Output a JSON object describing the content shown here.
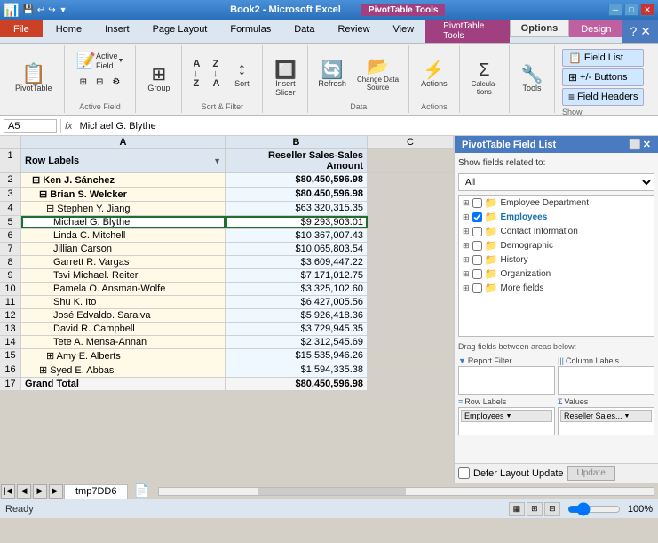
{
  "app": {
    "title": "Book2 - Microsoft Excel",
    "pivot_tools_label": "PivotTable Tools"
  },
  "title_buttons": [
    "─",
    "□",
    "✕"
  ],
  "tabs": {
    "main": [
      "File",
      "Home",
      "Insert",
      "Page Layout",
      "Formulas",
      "Data",
      "Review",
      "View"
    ],
    "pivot": [
      "Options",
      "Design"
    ]
  },
  "ribbon": {
    "groups": {
      "pivot_table": {
        "label": "PivotTable",
        "buttons": [
          "PivotTable"
        ]
      },
      "active_field": {
        "label": "Active Field",
        "main": "Active\nField"
      },
      "group_btn": "Group",
      "sort_filter": {
        "label": "Sort & Filter",
        "sort": "Sort"
      },
      "insert_slicer": "Insert\nSlicer",
      "data": {
        "label": "Data",
        "refresh": "Refresh",
        "change_data_source": "Change Data\nSource"
      },
      "actions": {
        "label": "Actions",
        "actions": "Actions"
      },
      "calculations": "Calculations",
      "tools": "Tools"
    },
    "show": {
      "label": "Show",
      "field_list": "Field List",
      "buttons": "+/- Buttons",
      "field_headers": "Field Headers"
    }
  },
  "formula_bar": {
    "cell_ref": "A5",
    "value": "Michael G. Blythe"
  },
  "spreadsheet": {
    "columns": [
      "",
      "A",
      "B",
      "C"
    ],
    "col_headers": [
      "Row Labels",
      "Reseller Sales-Sales Amount"
    ],
    "rows": [
      {
        "num": 1,
        "indent": 0,
        "label": "Row Labels",
        "value": "Reseller Sales-Sales Amount",
        "is_header": true
      },
      {
        "num": 2,
        "indent": 1,
        "label": "⊟ Ken J. Sánchez",
        "value": "$80,450,596.98",
        "bold": true
      },
      {
        "num": 3,
        "indent": 2,
        "label": "⊟ Brian S. Welcker",
        "value": "$80,450,596.98",
        "bold": true
      },
      {
        "num": 4,
        "indent": 3,
        "label": "⊟ Stephen Y. Jiang",
        "value": "$63,320,315.35",
        "bold": false
      },
      {
        "num": 5,
        "indent": 4,
        "label": "Michael G. Blythe",
        "value": "$9,293,903.01",
        "active": true
      },
      {
        "num": 6,
        "indent": 4,
        "label": "Linda C. Mitchell",
        "value": "$10,367,007.43"
      },
      {
        "num": 7,
        "indent": 4,
        "label": "Jillian Carson",
        "value": "$10,065,803.54"
      },
      {
        "num": 8,
        "indent": 4,
        "label": "Garrett R. Vargas",
        "value": "$3,609,447.22"
      },
      {
        "num": 9,
        "indent": 4,
        "label": "Tsvi Michael. Reiter",
        "value": "$7,171,012.75"
      },
      {
        "num": 10,
        "indent": 4,
        "label": "Pamela O. Ansman-Wolfe",
        "value": "$3,325,102.60"
      },
      {
        "num": 11,
        "indent": 4,
        "label": "Shu K. Ito",
        "value": "$6,427,005.56"
      },
      {
        "num": 12,
        "indent": 4,
        "label": "José Edvaldo. Saraiva",
        "value": "$5,926,418.36"
      },
      {
        "num": 13,
        "indent": 4,
        "label": "David R. Campbell",
        "value": "$3,729,945.35"
      },
      {
        "num": 14,
        "indent": 4,
        "label": "Tete A. Mensa-Annan",
        "value": "$2,312,545.69"
      },
      {
        "num": 15,
        "indent": 3,
        "label": "⊞ Amy E. Alberts",
        "value": "$15,535,946.26",
        "bold": false
      },
      {
        "num": 16,
        "indent": 2,
        "label": "⊞ Syed E. Abbas",
        "value": "$1,594,335.38",
        "bold": false
      },
      {
        "num": 17,
        "indent": 0,
        "label": "Grand Total",
        "value": "$80,450,596.98",
        "bold": true,
        "grand": true
      }
    ]
  },
  "pivot_panel": {
    "title": "PivotTable Field List",
    "show_label": "Show fields related to:",
    "dropdown_value": "(All)",
    "fields": [
      {
        "name": "Employee Department",
        "type": "folder",
        "expanded": false,
        "checked": false
      },
      {
        "name": "Employees",
        "type": "folder",
        "expanded": false,
        "checked": true
      },
      {
        "name": "Contact Information",
        "type": "folder",
        "expanded": false,
        "checked": false
      },
      {
        "name": "Demographic",
        "type": "folder",
        "expanded": false,
        "checked": false
      },
      {
        "name": "History",
        "type": "folder",
        "expanded": false,
        "checked": false
      },
      {
        "name": "Organization",
        "type": "folder",
        "expanded": false,
        "checked": false
      },
      {
        "name": "More fields",
        "type": "folder",
        "expanded": false,
        "checked": false
      }
    ],
    "drag_label": "Drag fields between areas below:",
    "areas": {
      "report_filter": {
        "label": "Report Filter",
        "icon": "▼"
      },
      "column_labels": {
        "label": "Column Labels",
        "icon": "|||"
      },
      "row_labels": {
        "label": "Row Labels",
        "icon": "≡",
        "item": "Employees"
      },
      "values": {
        "label": "Values",
        "icon": "Σ",
        "item": "Reseller Sales..."
      }
    },
    "defer_label": "Defer Layout Update",
    "update_label": "Update"
  },
  "sheet_tabs": {
    "active": "tmp7DD6",
    "tabs": [
      "tmp7DD6"
    ]
  },
  "status": {
    "ready": "Ready",
    "zoom": "100%"
  }
}
